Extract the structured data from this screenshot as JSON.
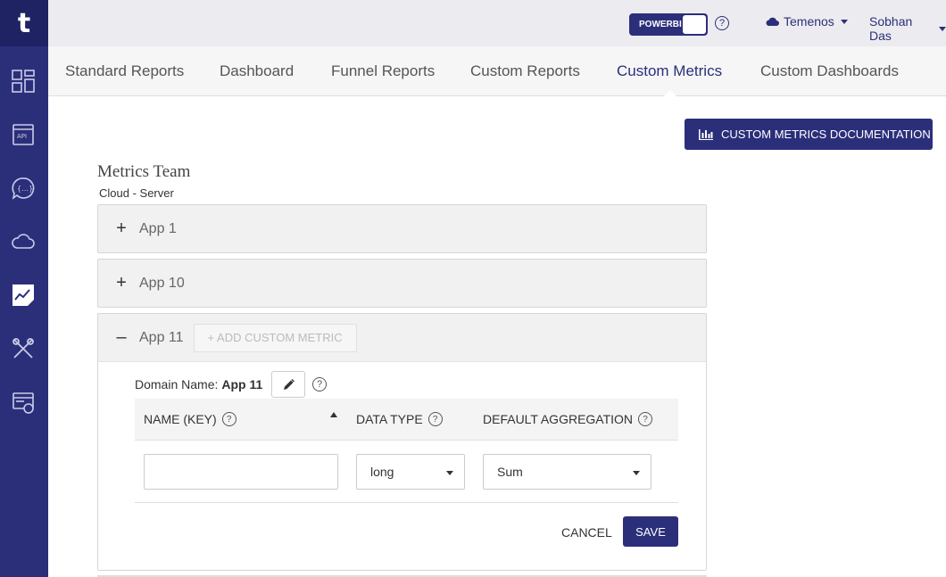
{
  "logo": "t",
  "topbar": {
    "toggle_label": "POWERBI",
    "help": "?",
    "org": "Temenos",
    "user": "Sobhan Das"
  },
  "nav": {
    "tabs": [
      {
        "label": "Standard Reports"
      },
      {
        "label": "Dashboard"
      },
      {
        "label": "Funnel Reports"
      },
      {
        "label": "Custom Reports"
      },
      {
        "label": "Custom Metrics"
      },
      {
        "label": "Custom Dashboards"
      }
    ],
    "active": "Custom Metrics"
  },
  "doc_button": "CUSTOM METRICS DOCUMENTATION",
  "team": {
    "title": "Metrics Team",
    "subtitle": "Cloud - Server"
  },
  "apps": [
    {
      "name": "App 1",
      "symbol": "+"
    },
    {
      "name": "App 10",
      "symbol": "+"
    },
    {
      "name": "App 11",
      "symbol": "–"
    }
  ],
  "expanded": {
    "add_metric": "+ ADD CUSTOM METRIC",
    "domain_label": "Domain Name:",
    "domain_value": "App 11",
    "help": "?",
    "columns": {
      "name": "NAME (KEY)",
      "data_type": "DATA TYPE",
      "aggregation": "DEFAULT AGGREGATION"
    },
    "name_value": "",
    "data_type_value": "long",
    "aggregation_value": "Sum",
    "cancel": "CANCEL",
    "save": "SAVE"
  }
}
